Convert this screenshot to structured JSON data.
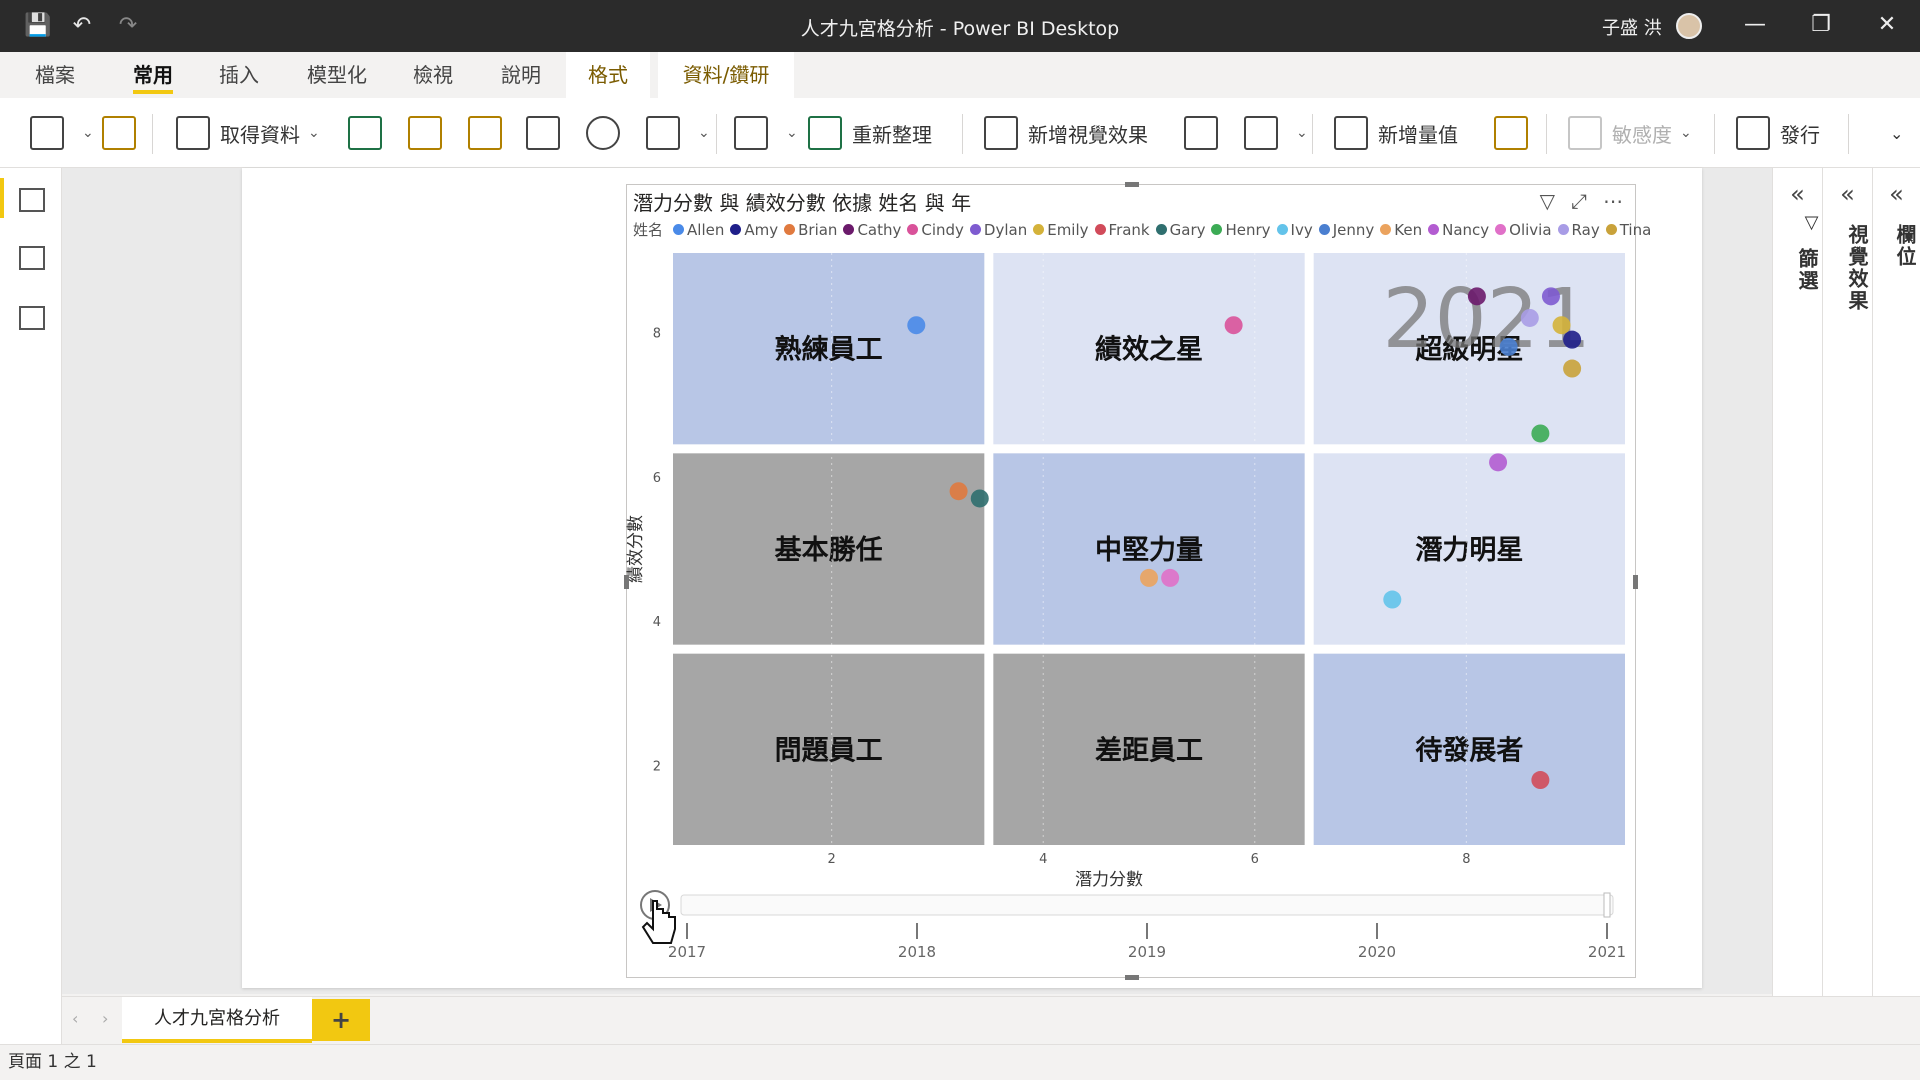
{
  "window": {
    "title": "人才九宮格分析 - Power BI Desktop",
    "user": "子盛 洪"
  },
  "tabs": [
    {
      "label": "檔案"
    },
    {
      "label": "常用"
    },
    {
      "label": "插入"
    },
    {
      "label": "模型化"
    },
    {
      "label": "檢視"
    },
    {
      "label": "說明"
    },
    {
      "label": "格式"
    },
    {
      "label": "資料/鑽研"
    }
  ],
  "ribbon": {
    "get_data": "取得資料",
    "refresh": "重新整理",
    "new_visual": "新增視覺效果",
    "new_measure": "新增量值",
    "sensitivity": "敏感度",
    "publish": "發行"
  },
  "visual": {
    "title": "潛力分數 與 績效分數 依據 姓名 與 年",
    "legend_title": "姓名",
    "play_axis_year": "2021"
  },
  "panes": {
    "filters": "篩選",
    "visualizations": "視覺效果",
    "fields": "欄位"
  },
  "page_tabs": {
    "current": "人才九宮格分析",
    "add": "+"
  },
  "status": "頁面 1 之 1",
  "chart_data": {
    "type": "scatter",
    "title": "潛力分數 與 績效分數 依據 姓名 與 年",
    "xlabel": "潛力分數",
    "ylabel": "績效分數",
    "xlim": [
      0.5,
      9.5
    ],
    "ylim": [
      0.9,
      9.1
    ],
    "x_ticks": [
      2,
      4,
      6,
      8
    ],
    "y_ticks": [
      2,
      4,
      6,
      8
    ],
    "legend_title": "姓名",
    "legend_placement": "top-left",
    "series": [
      {
        "name": "Allen",
        "color": "#4a8ae8",
        "x": 2.8,
        "y": 8.1
      },
      {
        "name": "Amy",
        "color": "#1f1f8a",
        "x": 9.0,
        "y": 7.9
      },
      {
        "name": "Brian",
        "color": "#e07a3f",
        "x": 3.2,
        "y": 5.8
      },
      {
        "name": "Cathy",
        "color": "#6b1a6b",
        "x": 8.1,
        "y": 8.5
      },
      {
        "name": "Cindy",
        "color": "#d9529a",
        "x": 5.8,
        "y": 8.1
      },
      {
        "name": "Dylan",
        "color": "#7e5bd0",
        "x": 8.8,
        "y": 8.5
      },
      {
        "name": "Emily",
        "color": "#d4b23a",
        "x": 8.9,
        "y": 8.1
      },
      {
        "name": "Frank",
        "color": "#d14b5a",
        "x": 8.7,
        "y": 1.8
      },
      {
        "name": "Gary",
        "color": "#2f6f6f",
        "x": 3.4,
        "y": 5.7
      },
      {
        "name": "Henry",
        "color": "#3cab55",
        "x": 8.7,
        "y": 6.6
      },
      {
        "name": "Ivy",
        "color": "#63c3ea",
        "x": 7.3,
        "y": 4.3
      },
      {
        "name": "Jenny",
        "color": "#4a7fd0",
        "x": 8.4,
        "y": 7.8
      },
      {
        "name": "Ken",
        "color": "#eba35e",
        "x": 5.0,
        "y": 4.6
      },
      {
        "name": "Nancy",
        "color": "#b35cd1",
        "x": 8.3,
        "y": 6.2
      },
      {
        "name": "Olivia",
        "color": "#e070c8",
        "x": 5.2,
        "y": 4.6
      },
      {
        "name": "Ray",
        "color": "#a89ce6",
        "x": 8.6,
        "y": 8.2
      },
      {
        "name": "Tina",
        "color": "#c9a23a",
        "x": 9.0,
        "y": 7.5
      }
    ],
    "quadrants": [
      {
        "label": "熟練員工",
        "col": 0,
        "row": 0,
        "color": "#b8c6e6"
      },
      {
        "label": "績效之星",
        "col": 1,
        "row": 0,
        "color": "#dde3f3"
      },
      {
        "label": "超級明星",
        "col": 2,
        "row": 0,
        "color": "#dde3f3"
      },
      {
        "label": "基本勝任",
        "col": 0,
        "row": 1,
        "color": "#a6a6a6"
      },
      {
        "label": "中堅力量",
        "col": 1,
        "row": 1,
        "color": "#b8c6e6"
      },
      {
        "label": "潛力明星",
        "col": 2,
        "row": 1,
        "color": "#dde3f3"
      },
      {
        "label": "問題員工",
        "col": 0,
        "row": 2,
        "color": "#a6a6a6"
      },
      {
        "label": "差距員工",
        "col": 1,
        "row": 2,
        "color": "#a6a6a6"
      },
      {
        "label": "待發展者",
        "col": 2,
        "row": 2,
        "color": "#b8c6e6"
      }
    ],
    "play_axis": {
      "years": [
        "2017",
        "2018",
        "2019",
        "2020",
        "2021"
      ],
      "current": "2021"
    }
  }
}
